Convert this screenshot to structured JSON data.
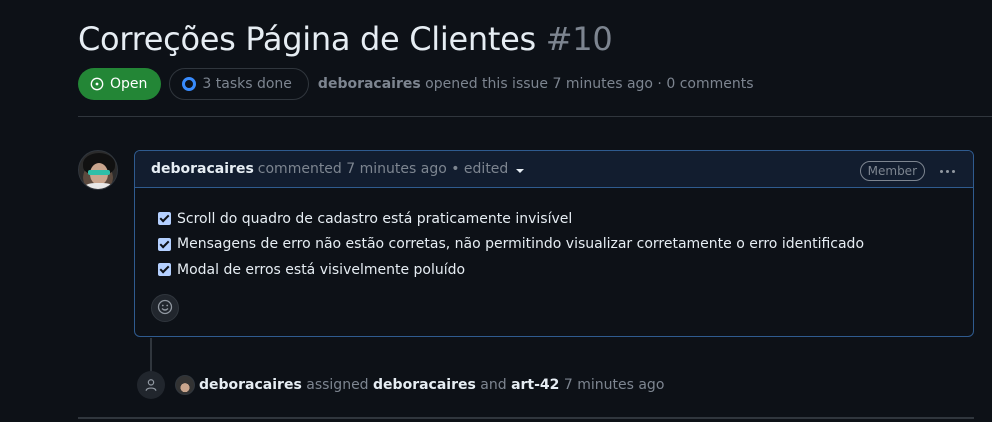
{
  "issue": {
    "title": "Correções Página de Clientes",
    "number": "#10",
    "state_label": "Open",
    "tasks_label": "3 tasks done",
    "author": "deboracaires",
    "opened_text": "opened this issue 7 minutes ago · 0 comments"
  },
  "comment": {
    "author": "deboracaires",
    "meta": "commented 7 minutes ago • edited",
    "role_badge": "Member",
    "tasks": [
      {
        "text": "Scroll do quadro de cadastro está praticamente invisível",
        "checked": true
      },
      {
        "text": "Mensagens de erro não estão corretas, não permitindo visualizar corretamente o erro identificado",
        "checked": true
      },
      {
        "text": "Modal de erros está visivelmente poluído",
        "checked": true
      }
    ]
  },
  "event": {
    "actor": "deboracaires",
    "action": "assigned",
    "assignee1": "deboracaires",
    "conjunction": "and",
    "assignee2": "art-42",
    "time": "7 minutes ago"
  },
  "colors": {
    "open_green": "#238636",
    "accent_blue": "#388bfd",
    "background": "#0d1117",
    "muted": "#7d8590"
  }
}
